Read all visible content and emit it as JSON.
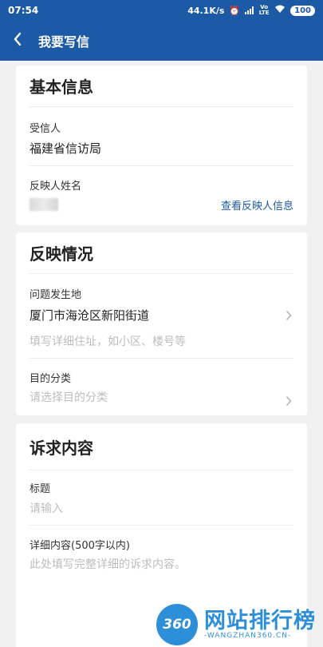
{
  "status_bar": {
    "time": "07:54",
    "net_speed": "44.1K/s",
    "volte": "Vo LTE",
    "battery": "100"
  },
  "header": {
    "title": "我要写信",
    "back_icon": "chevron-left-icon"
  },
  "basic_info": {
    "title": "基本信息",
    "recipient_label": "受信人",
    "recipient_value": "福建省信访局",
    "reporter_label": "反映人姓名",
    "view_reporter_link": "查看反映人信息"
  },
  "situation": {
    "title": "反映情况",
    "location_label": "问题发生地",
    "location_value": "厦门市海沧区新阳街道",
    "address_placeholder": "填写详细住址，如小区、楼号等",
    "category_label": "目的分类",
    "category_placeholder": "请选择目的分类"
  },
  "appeal": {
    "title": "诉求内容",
    "subject_label": "标题",
    "subject_placeholder": "请输入",
    "detail_label": "详细内容(500字以内)",
    "detail_placeholder": "此处填写完整详细的诉求内容。"
  },
  "watermark": {
    "badge": "360",
    "text": "网站排行榜",
    "sub": "-WANGZHAN360.CN-"
  },
  "colors": {
    "brand": "#1d5aa6",
    "background": "#f1f1f1",
    "placeholder": "#bdbdbd",
    "watermark": "#2e8fd9"
  }
}
